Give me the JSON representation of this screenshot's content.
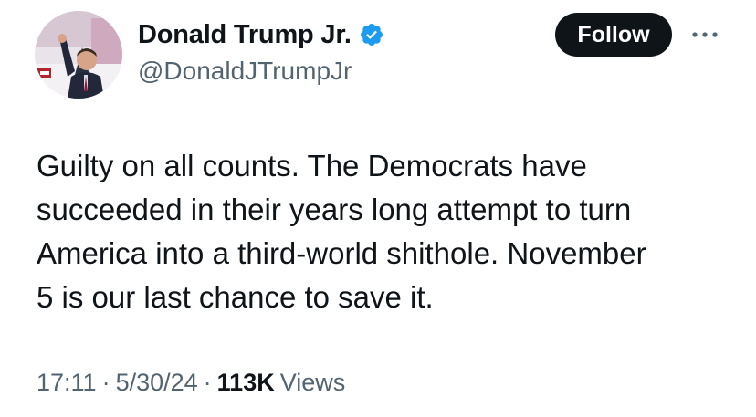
{
  "author": {
    "display_name": "Donald Trump Jr.",
    "handle": "@DonaldJTrumpJr",
    "verified": true,
    "verified_color": "#1d9bf0"
  },
  "actions": {
    "follow_label": "Follow",
    "more_icon": "more-horizontal-icon"
  },
  "tweet": {
    "lines": [
      "Guilty on all counts. The Democrats have",
      "succeeded in their years long attempt to turn",
      "America into a third-world shithole. November",
      "5 is our last chance to save it."
    ]
  },
  "meta": {
    "time": "17:11",
    "date": "5/30/24",
    "views_count": "113K",
    "views_label": "Views",
    "separator": "·"
  },
  "colors": {
    "text_primary": "#0f1419",
    "text_secondary": "#536471",
    "button_bg": "#0f1419",
    "button_text": "#ffffff"
  }
}
